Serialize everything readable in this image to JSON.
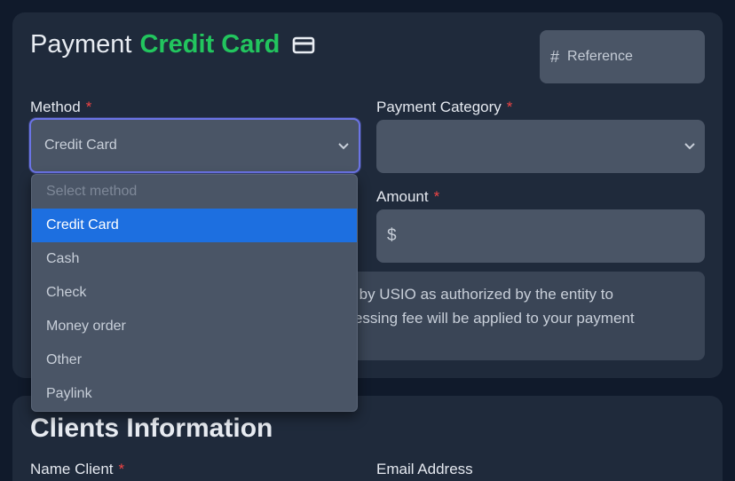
{
  "payment": {
    "title_prefix": "Payment",
    "title_accent": "Credit Card",
    "reference_placeholder": "Reference",
    "method_label": "Method",
    "method_value": "Credit Card",
    "category_label": "Payment Category",
    "category_value": "",
    "amount_label": "Amount",
    "amount_prefix": "$",
    "notice_line1": "ed by USIO as authorized by the entity to",
    "notice_line2": "ocessing fee will be applied to your payment",
    "required_marker": "*"
  },
  "method_dropdown": {
    "placeholder": "Select method",
    "options": [
      "Credit Card",
      "Cash",
      "Check",
      "Money order",
      "Other",
      "Paylink"
    ],
    "selected": "Credit Card"
  },
  "clients": {
    "title": "Clients Information",
    "name_label": "Name Client",
    "email_label": "Email Address",
    "required_marker": "*"
  },
  "colors": {
    "background": "#101a2b",
    "card": "#1f2a3b",
    "input": "#4a5566",
    "accent_green": "#22c55e",
    "required_red": "#ef4444",
    "selected_blue": "#1d6fe0",
    "focus_ring": "#6b74e6"
  },
  "icons": {
    "title_icon": "credit-card-icon",
    "reference_icon": "hash-icon",
    "select_icon": "chevron-down-icon"
  }
}
